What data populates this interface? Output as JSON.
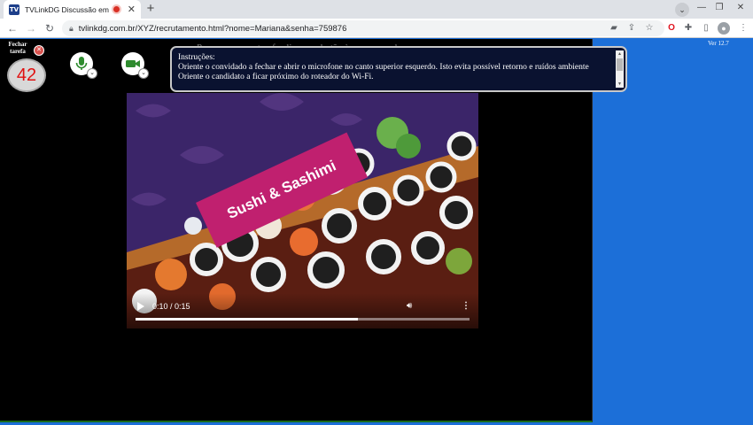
{
  "browser": {
    "tab_title": "TVLinkDG Discussão em Grupo",
    "tab_favicon_text": "TV",
    "new_tab_symbol": "+",
    "url": "tvlinkdg.com.br/XYZ/recrutamento.html?nome=Mariana&senha=759876"
  },
  "app": {
    "version": "Ver 12.7",
    "close_task_label": "Fechar tarefa",
    "timer_value": "42",
    "hint": "Para encerrar a tarefa clique no botão à sua esquerda.",
    "instructions": {
      "title": "Instruções:",
      "lines": [
        "Oriente o convidado a fechar e abrir o microfone no canto superior esquerdo. Isto evita possível retorno e ruídos ambiente",
        "Oriente o candidato a ficar próximo do roteador do Wi-Fi."
      ]
    }
  },
  "video": {
    "banner_text": "Sushi & Sashimi",
    "time_display": "0:10 / 0:15",
    "progress_fraction": 0.667
  },
  "colors": {
    "accent_blue": "#1c6fd8",
    "timer_red": "#e01010",
    "mic_green": "#2e8b2e",
    "banner_magenta": "#c0206f"
  }
}
